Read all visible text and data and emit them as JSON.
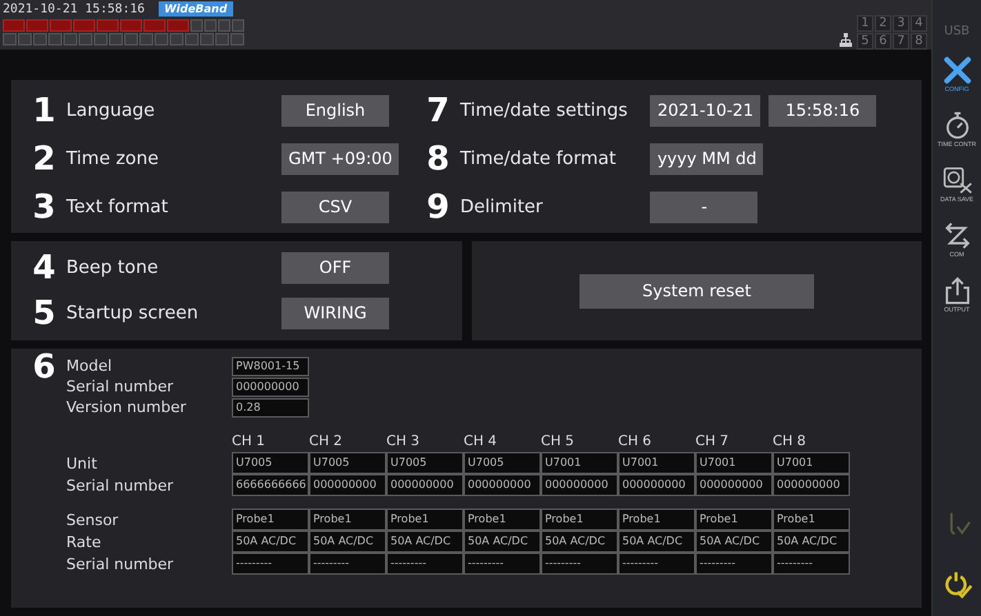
{
  "status_bar": {
    "datetime": "2021-10-21  15:58:16",
    "mode_badge": "WideBand",
    "channel_numbers": [
      "1",
      "2",
      "3",
      "4",
      "5",
      "6",
      "7",
      "8"
    ]
  },
  "settings": {
    "left": [
      {
        "number": "1",
        "label": "Language",
        "values": [
          "English"
        ]
      },
      {
        "number": "2",
        "label": "Time zone",
        "values": [
          "GMT +09:00"
        ]
      },
      {
        "number": "3",
        "label": "Text format",
        "values": [
          "CSV"
        ]
      }
    ],
    "right": [
      {
        "number": "7",
        "label": "Time/date settings",
        "values": [
          "2021-10-21",
          "15:58:16"
        ]
      },
      {
        "number": "8",
        "label": "Time/date format",
        "values": [
          "yyyy MM dd"
        ]
      },
      {
        "number": "9",
        "label": "Delimiter",
        "values": [
          "-"
        ]
      }
    ],
    "sound": [
      {
        "number": "4",
        "label": "Beep tone",
        "values": [
          "OFF"
        ]
      },
      {
        "number": "5",
        "label": "Startup screen",
        "values": [
          "WIRING"
        ]
      }
    ],
    "reset_button": "System reset"
  },
  "info": {
    "number": "6",
    "device": [
      {
        "label": "Model",
        "value": "PW8001-15"
      },
      {
        "label": "Serial number",
        "value": "000000000"
      },
      {
        "label": "Version number",
        "value": "0.28"
      }
    ],
    "channels": [
      "CH 1",
      "CH 2",
      "CH 3",
      "CH 4",
      "CH 5",
      "CH 6",
      "CH 7",
      "CH 8"
    ],
    "groups": [
      {
        "rows": [
          {
            "label": "Unit",
            "cells": [
              "U7005",
              "U7005",
              "U7005",
              "U7005",
              "U7001",
              "U7001",
              "U7001",
              "U7001"
            ]
          },
          {
            "label": "Serial number",
            "cells": [
              "6666666666",
              "000000000",
              "000000000",
              "000000000",
              "000000000",
              "000000000",
              "000000000",
              "000000000"
            ]
          }
        ]
      },
      {
        "rows": [
          {
            "label": "Sensor",
            "cells": [
              "Probe1",
              "Probe1",
              "Probe1",
              "Probe1",
              "Probe1",
              "Probe1",
              "Probe1",
              "Probe1"
            ]
          },
          {
            "label": "Rate",
            "cells": [
              "50A AC/DC",
              "50A AC/DC",
              "50A AC/DC",
              "50A AC/DC",
              "50A AC/DC",
              "50A AC/DC",
              "50A AC/DC",
              "50A AC/DC"
            ]
          },
          {
            "label": "Serial number",
            "cells": [
              "---------",
              "---------",
              "---------",
              "---------",
              "---------",
              "---------",
              "---------",
              "---------"
            ]
          }
        ]
      }
    ]
  },
  "sidebar": {
    "header": "USB",
    "items": [
      {
        "kind": "config",
        "label": "CONFIG",
        "selected": true
      },
      {
        "kind": "time",
        "label": "TIME CONTR",
        "selected": false
      },
      {
        "kind": "save",
        "label": "DATA SAVE",
        "selected": false
      },
      {
        "kind": "com",
        "label": "COM",
        "selected": false
      },
      {
        "kind": "output",
        "label": "OUTPUT",
        "selected": false
      }
    ]
  }
}
